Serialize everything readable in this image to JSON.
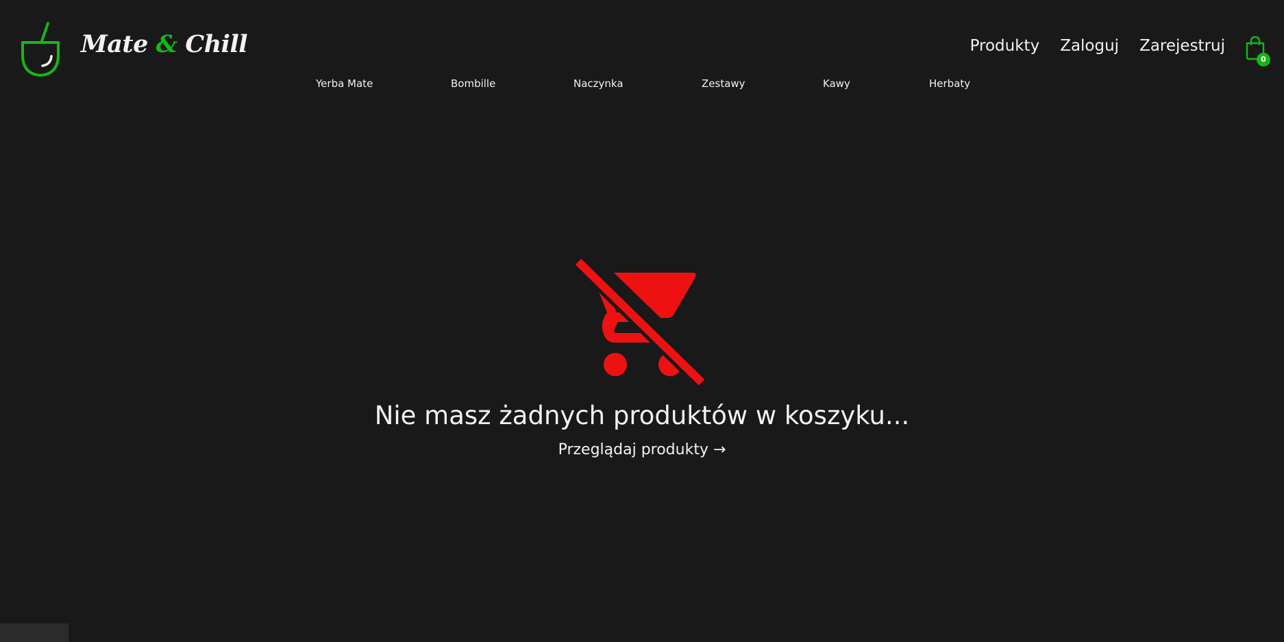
{
  "brand": {
    "name_part1": "Mate",
    "name_amp": "&",
    "name_part2": "Chill",
    "icon": "mate-cup-icon",
    "accent_color": "#14b814"
  },
  "top_nav": {
    "items": [
      {
        "label": "Produkty"
      },
      {
        "label": "Zaloguj"
      },
      {
        "label": "Zarejestruj"
      }
    ]
  },
  "cart": {
    "icon": "shopping-bag-icon",
    "count": "0"
  },
  "categories": [
    {
      "label": "Yerba Mate"
    },
    {
      "label": "Bombille"
    },
    {
      "label": "Naczynka"
    },
    {
      "label": "Zestawy"
    },
    {
      "label": "Kawy"
    },
    {
      "label": "Herbaty"
    }
  ],
  "empty_cart": {
    "icon": "remove-shopping-cart-icon",
    "icon_color": "#ee1111",
    "message": "Nie masz żadnych produktów w koszyku...",
    "link_label": "Przeglądaj produkty →"
  },
  "colors": {
    "background": "#191919",
    "text": "#f2f2f2"
  }
}
